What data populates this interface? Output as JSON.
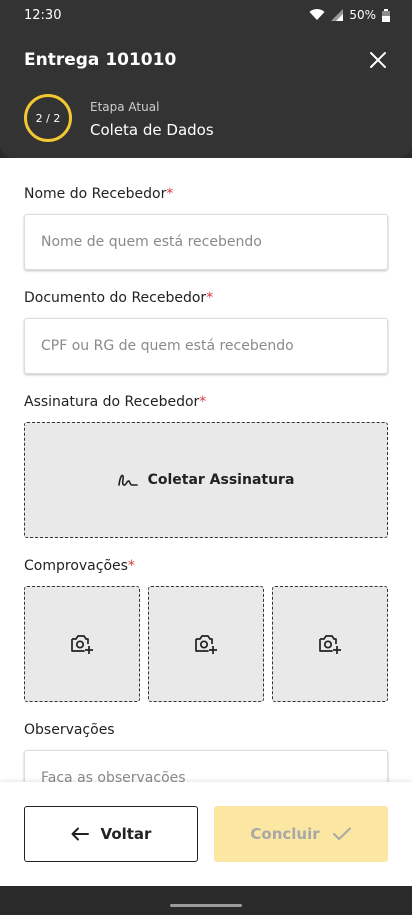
{
  "status_bar": {
    "time": "12:30",
    "battery": "50%"
  },
  "header": {
    "title": "Entrega 101010",
    "step_progress": "2 / 2",
    "step_label": "Etapa Atual",
    "step_value": "Coleta de Dados"
  },
  "form": {
    "nome": {
      "label": "Nome do Recebedor",
      "required": "*",
      "placeholder": "Nome de quem está recebendo"
    },
    "documento": {
      "label": "Documento do Recebedor",
      "required": "*",
      "placeholder": "CPF ou RG de quem está recebendo"
    },
    "assinatura": {
      "label": "Assinatura do Recebedor",
      "required": "*",
      "button_label": "Coletar Assinatura"
    },
    "comprovacoes": {
      "label": "Comprovações",
      "required": "*"
    },
    "observacoes": {
      "label": "Observações",
      "placeholder": "Faça as observações"
    }
  },
  "footer": {
    "back_label": "Voltar",
    "finish_label": "Concluir"
  },
  "colors": {
    "accent": "#f2c832",
    "header_bg": "#333333",
    "required": "#d83a3a",
    "finish_disabled_bg": "#fbe7a1"
  }
}
